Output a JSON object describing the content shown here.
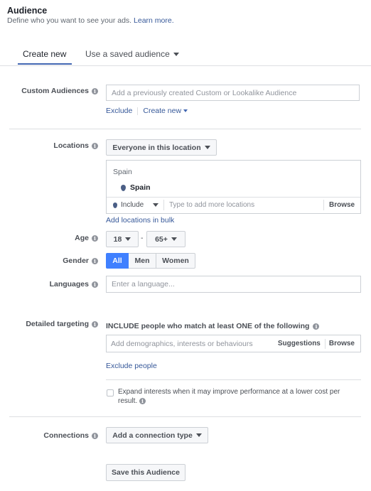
{
  "header": {
    "title": "Audience",
    "subtitle": "Define who you want to see your ads.",
    "learn_more": "Learn more."
  },
  "tabs": {
    "create_new": "Create new",
    "saved": "Use a saved audience"
  },
  "custom_audiences": {
    "label": "Custom Audiences",
    "placeholder": "Add a previously created Custom or Lookalike Audience",
    "exclude": "Exclude",
    "create_new": "Create new"
  },
  "locations": {
    "label": "Locations",
    "dropdown": "Everyone in this location",
    "group_header": "Spain",
    "selected_item": "Spain",
    "include": "Include",
    "search_placeholder": "Type to add more locations",
    "browse": "Browse",
    "bulk_link": "Add locations in bulk"
  },
  "age": {
    "label": "Age",
    "min": "18",
    "dash": "-",
    "max": "65+"
  },
  "gender": {
    "label": "Gender",
    "options": [
      "All",
      "Men",
      "Women"
    ],
    "selected": "All"
  },
  "languages": {
    "label": "Languages",
    "placeholder": "Enter a language..."
  },
  "detailed_targeting": {
    "label": "Detailed targeting",
    "include_text": "INCLUDE people who match at least ONE of the following",
    "placeholder": "Add demographics, interests or behaviours",
    "suggestions": "Suggestions",
    "browse": "Browse",
    "exclude_link": "Exclude people",
    "expand_text": "Expand interests when it may improve performance at a lower cost per result.",
    "expand_checked": false
  },
  "connections": {
    "label": "Connections",
    "dropdown": "Add a connection type"
  },
  "save_button": "Save this Audience",
  "colors": {
    "accent": "#4267b2",
    "link": "#365899",
    "active_segment": "#4080ff"
  }
}
